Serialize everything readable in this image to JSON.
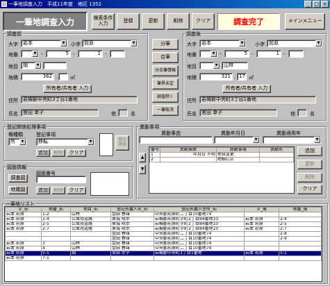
{
  "window": {
    "title": "一筆地調査入力　平成11年度　地区 1352"
  },
  "header": {
    "title": "一筆地調査入力",
    "buttons": {
      "search": "検索条件\n入力",
      "register": "登録",
      "update": "更新",
      "delete": "削除",
      "clear": "クリア",
      "menu": "メインメニュー"
    },
    "status": "調査完了"
  },
  "before": {
    "title": "調査前",
    "oaza_label": "大字",
    "oaza_value": "岩本",
    "koaza_label": "小字",
    "koaza_value": "前原",
    "chiban_label": "地番",
    "chiban_1": "5",
    "chiban_2": "1",
    "chimoku_label": "地目",
    "chimoku_value": "畑",
    "chiseki_label": "地積",
    "chiseki_value": "362",
    "chiseki_unit": "㎡",
    "owner_button": "所有者/共有者 入力",
    "address_label": "住所",
    "address_value": "岩槻郡中央町3丁目1番地",
    "name_label": "氏名",
    "name_value": "宮田 幸子",
    "extra_label": "他",
    "extra_unit": "名"
  },
  "middle_buttons": [
    "分筆",
    "合筆",
    "分合筆情報",
    "筆界未定",
    "調査除く",
    "一筆取消"
  ],
  "after": {
    "title": "調査後",
    "oaza_label": "大字",
    "oaza_value": "岩本",
    "koaza_label": "小字",
    "koaza_value": "前原",
    "chiban_label": "地番",
    "chiban_1": "5",
    "chiban_2": "1",
    "chimoku_label": "地目",
    "chimoku_value": "山林",
    "chiseki_label": "地積",
    "chiseki_value": "321",
    "chiseki_decimal": "17",
    "chiseki_unit": "㎡",
    "owner_button": "所有者/共有者 入力",
    "address_label": "住所",
    "address_value": "岩槻郡中央町3丁目1番地",
    "name_label": "氏名",
    "name_value": "宮田 幸子",
    "extra_label": "他",
    "extra_unit": "名"
  },
  "registry": {
    "title": "登記関係処理事項",
    "kind_label": "権種類",
    "kind_value": "所",
    "item_label": "登記事項",
    "item_value": "移転",
    "btn_add": "追加",
    "btn_delete": "削除",
    "btn_clear": "クリア",
    "btn_side": "登記\n関係"
  },
  "survey_map": {
    "title": "図面情報",
    "number_label": "図面番号",
    "btn_survey": "調査図",
    "btn_map": "地籍図",
    "btn_add": "追加",
    "btn_delete": "削除",
    "btn_clear": "クリア"
  },
  "changes": {
    "title": "異動事項",
    "reason_label": "異動事由",
    "date_label": "異動年月日",
    "apply_label": "異動適用年",
    "columns": [
      "番号",
      "異動事由",
      "異動事項",
      "異動名"
    ],
    "rows": [
      [
        "1",
        "年月日 不明",
        "地目変更",
        ""
      ],
      [
        "2",
        "",
        "地積訂正",
        ""
      ]
    ],
    "btn_add": "追加",
    "btn_update": "更新",
    "btn_delete": "削除",
    "btn_clear": "クリア"
  },
  "list": {
    "title": "一筆地リスト",
    "columns": [
      "字_前",
      "地番_前",
      "地目_前",
      "登記名義人名_前",
      "登記名義人住所_前",
      "字_後",
      "地番_後"
    ],
    "rows": [
      [
        "岩本 前原",
        "1-2",
        "山林",
        "金田 春雄",
        "中央郡前原町二丁目10番地74",
        "",
        ""
      ],
      [
        "岩本 前原",
        "2-4",
        "公衆用道路",
        "奥城 晴幸",
        "岩槻郡前原町字町2丁目84番地10",
        "岩本 前原",
        "2-4"
      ],
      [
        "岩本 前原",
        "2-5",
        "公衆用道路",
        "奥城 晴幸",
        "岩槻郡前原町字町2丁目84番地10",
        "岩本 前原",
        "2-5"
      ],
      [
        "岩本 前原",
        "2-7",
        "公衆用道路",
        "奥城 晴幸",
        "岩槻郡前原町字町2丁目84番地10",
        "岩本 前原",
        "2-7"
      ],
      [
        "",
        "",
        "",
        "金田 春雄",
        "中央郡前原町二丁目10番地74",
        "",
        "2-8"
      ],
      [
        "",
        "",
        "",
        "金田 春雄",
        "中央郡前原町二丁目10番地74",
        "",
        "2-9"
      ],
      [
        "岩本 前原",
        "3",
        "山林",
        "金田 春雄",
        "中央郡前原町二丁目10番地74",
        "",
        ""
      ],
      [
        "岩本 前原",
        "4",
        "山林",
        "金田 春雄",
        "中央郡前原町二丁目10番地74",
        "",
        ""
      ],
      [
        "岩本 前原",
        "5-1",
        "畑",
        "宮田 幸子",
        "岩槻郡中央町3丁目1番地",
        "岩本 前原",
        "5-1"
      ],
      [
        "岩本 前原",
        "7-1",
        "",
        "",
        "",
        "",
        ""
      ]
    ],
    "selected_row": 8
  }
}
